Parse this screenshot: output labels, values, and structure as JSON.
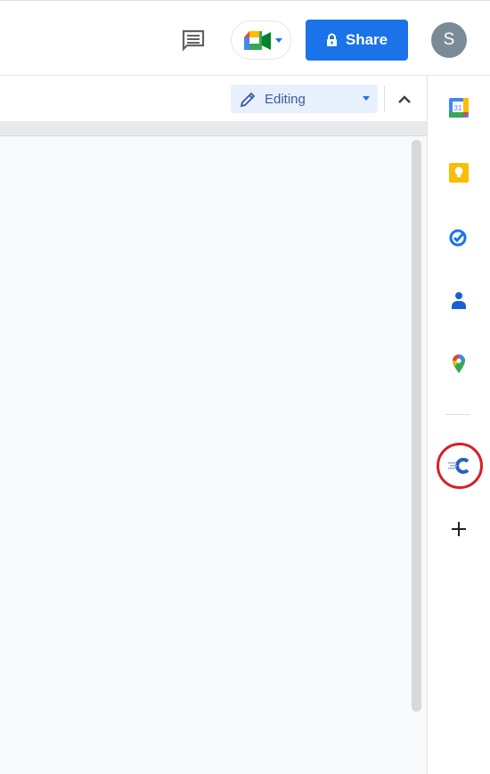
{
  "header": {
    "comment_icon": "comment-icon",
    "meet_icon": "google-meet-icon",
    "share_label": "Share",
    "share_icon": "lock-icon",
    "avatar_initial": "S"
  },
  "toolbar": {
    "mode_label": "Editing",
    "mode_icon": "pencil-icon",
    "collapse_icon": "chevron-up-icon"
  },
  "side_panel": {
    "items": [
      {
        "name": "Calendar",
        "icon": "google-calendar-icon",
        "text": "31"
      },
      {
        "name": "Keep",
        "icon": "google-keep-icon"
      },
      {
        "name": "Tasks",
        "icon": "google-tasks-icon"
      },
      {
        "name": "Contacts",
        "icon": "google-contacts-icon"
      },
      {
        "name": "Maps",
        "icon": "google-maps-icon"
      },
      {
        "name": "Add-on",
        "icon": "addon-c-icon",
        "highlighted": true
      },
      {
        "name": "Get add-ons",
        "icon": "plus-icon"
      }
    ]
  },
  "colors": {
    "accent": "#1a73e8",
    "editing_bg": "#e8f0fe",
    "highlight_ring": "#d81f26"
  }
}
